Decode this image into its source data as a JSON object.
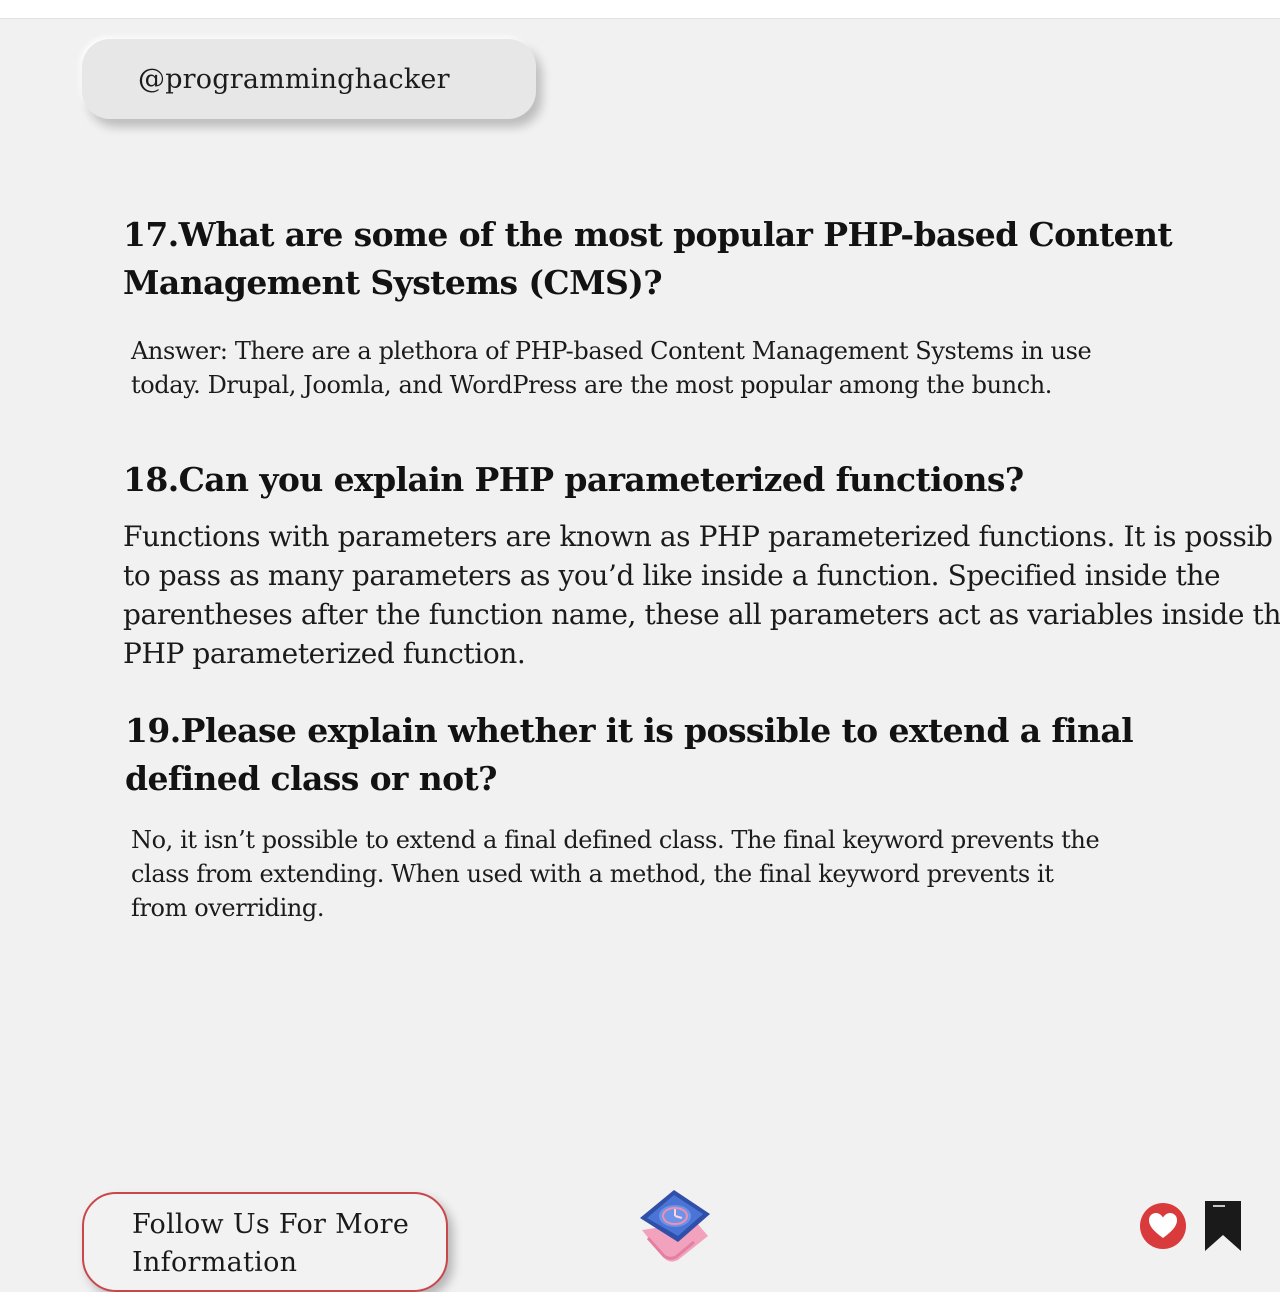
{
  "header": {
    "handle": "@programminghacker"
  },
  "qa": [
    {
      "question_lines": [
        "17.What are some of the most popular PHP-based Content",
        "Management Systems (CMS)?"
      ],
      "answer_lines": [
        "Answer: There are a plethora of PHP-based Content Management Systems in use",
        "today. Drupal, Joomla, and WordPress are the most popular among the bunch."
      ]
    },
    {
      "question_lines": [
        "18.Can you explain PHP parameterized functions?"
      ],
      "answer_lines": [
        "Functions with parameters are known as PHP parameterized functions. It is possib",
        "to pass as many parameters as you’d like inside a function. Specified inside the",
        "parentheses after the function name, these all parameters act as variables inside th",
        "PHP parameterized function."
      ]
    },
    {
      "question_lines": [
        "19.Please explain whether it is possible to extend a final",
        "defined class or not?"
      ],
      "answer_lines": [
        "No, it isn’t possible to extend a final defined class. The final keyword prevents the",
        "class from extending. When used with a method, the final keyword prevents it",
        "from overriding."
      ]
    }
  ],
  "footer": {
    "follow_lines": [
      "Follow Us For More",
      "Information"
    ],
    "icons": {
      "logo": "smartwatch-logo-icon",
      "like": "heart-icon",
      "save": "bookmark-icon"
    }
  },
  "colors": {
    "background": "#f2f1f2",
    "accent_red": "#d93a3c",
    "bookmark": "#1a1a1a",
    "watch_blue": "#3f63c4",
    "watch_pink": "#f08fb0"
  }
}
